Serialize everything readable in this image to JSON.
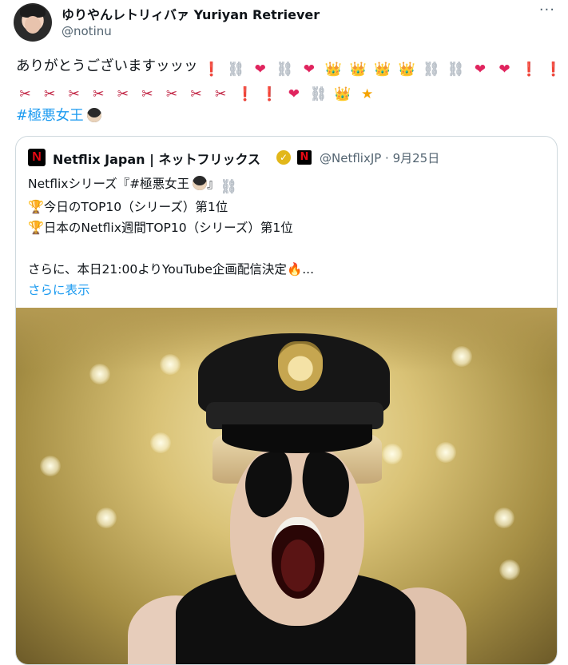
{
  "author": {
    "name": "ゆりやんレトリィバァ Yuriyan Retriever",
    "handle": "@notinu"
  },
  "more_label": "···",
  "tweet": {
    "text": "ありがとうございますッッッ",
    "hashtag": "#極悪女王"
  },
  "emoji": {
    "bang": "❗",
    "chain": "⛓",
    "fire_heart": "❤",
    "crown": "👑",
    "scissors": "✂",
    "star": "★",
    "trophy": "🏆",
    "fire": "🔥"
  },
  "quote": {
    "name": "Netflix Japan | ネットフリックス",
    "handle_date": "@NetflixJP · 9月25日",
    "logo_letter": "N",
    "line1": "Netflixシリーズ『#極悪女王",
    "line1_end": "』",
    "line2": "今日のTOP10（シリーズ）第1位",
    "line3": "日本のNetflix週間TOP10（シリーズ）第1位",
    "line4": "さらに、本日21:00よりYouTube企画配信決定",
    "line4_end": "...",
    "show_more": "さらに表示"
  }
}
